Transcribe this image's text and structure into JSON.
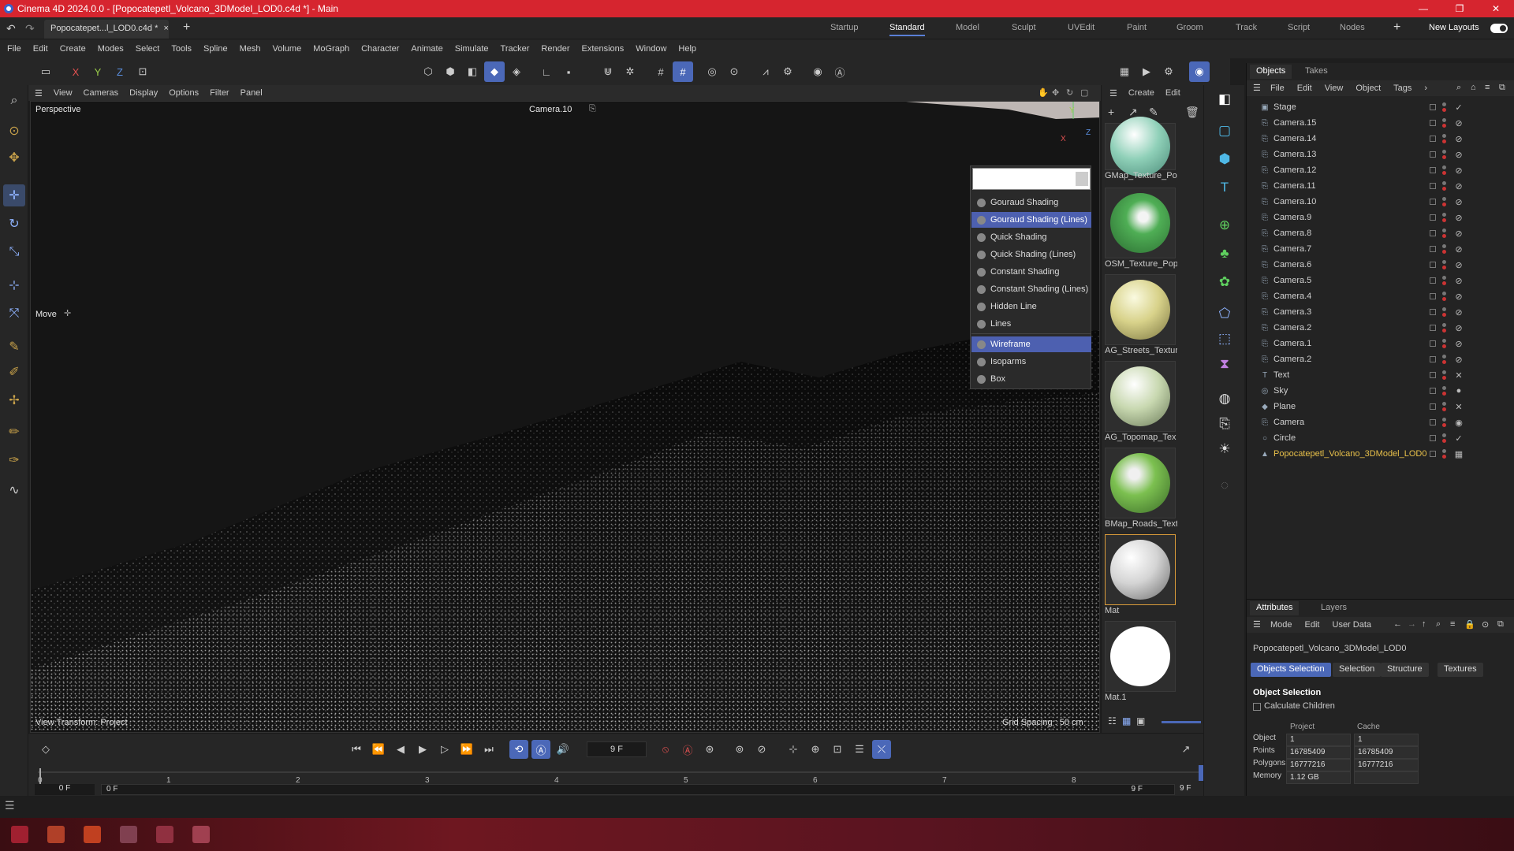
{
  "window": {
    "title": "Cinema 4D 2024.0.0 - [Popocatepetl_Volcano_3DModel_LOD0.c4d *] - Main",
    "minimize": "—",
    "maximize": "❐",
    "close": "✕"
  },
  "doc_tab": {
    "label": "Popocatepet...l_LOD0.c4d *",
    "close": "×",
    "add": "+"
  },
  "layouts": [
    "Startup",
    "Standard",
    "Model",
    "Sculpt",
    "UVEdit",
    "Paint",
    "Groom",
    "Track",
    "Script",
    "Nodes"
  ],
  "layout_add": "+",
  "new_layouts": "New Layouts",
  "menu": [
    "File",
    "Edit",
    "Create",
    "Modes",
    "Select",
    "Tools",
    "Spline",
    "Mesh",
    "Volume",
    "MoGraph",
    "Character",
    "Animate",
    "Simulate",
    "Tracker",
    "Render",
    "Extensions",
    "Window",
    "Help"
  ],
  "axes": {
    "x": "X",
    "y": "Y",
    "z": "Z"
  },
  "viewport": {
    "menu": [
      "View",
      "Cameras",
      "Display",
      "Options",
      "Filter",
      "Panel"
    ],
    "label": "Perspective",
    "camera": "Camera.10",
    "tool": "Move",
    "view_transform": "View Transform: Project",
    "grid_spacing": "Grid Spacing : 50 cm",
    "axis_x": "X",
    "axis_y": "Y",
    "axis_z": "Z"
  },
  "shading_menu": {
    "items": [
      {
        "label": "Gouraud Shading",
        "selected": false
      },
      {
        "label": "Gouraud Shading (Lines)",
        "selected": true
      },
      {
        "label": "Quick Shading",
        "selected": false
      },
      {
        "label": "Quick Shading (Lines)",
        "selected": false
      },
      {
        "label": "Constant Shading",
        "selected": false
      },
      {
        "label": "Constant Shading (Lines)",
        "selected": false
      },
      {
        "label": "Hidden Line",
        "selected": false
      },
      {
        "label": "Lines",
        "selected": false
      }
    ],
    "items2": [
      {
        "label": "Wireframe",
        "selected": true
      },
      {
        "label": "Isoparms",
        "selected": false
      },
      {
        "label": "Box",
        "selected": false
      }
    ]
  },
  "materials": {
    "menu": [
      "Create",
      "Edit"
    ],
    "items": [
      {
        "name": "GMap_Texture_Po",
        "color": "#8fd0b8"
      },
      {
        "name": "OSM_Texture_Pop",
        "color": "#4fae55"
      },
      {
        "name": "AG_Streets_Textur",
        "color": "#d8d28a"
      },
      {
        "name": "AG_Topomap_Tex",
        "color": "#c8d8b0"
      },
      {
        "name": "BMap_Roads_Text",
        "color": "#7cc050"
      },
      {
        "name": "Mat",
        "color": "#e4e4e4"
      },
      {
        "name": "Mat.1",
        "color": "#ffffff"
      }
    ]
  },
  "objects_panel": {
    "tabs": [
      "Objects",
      "Takes"
    ],
    "menu": [
      "File",
      "Edit",
      "View",
      "Object",
      "Tags"
    ],
    "rows": [
      {
        "name": "Stage",
        "icon": "▣",
        "tag": "✓"
      },
      {
        "name": "Camera.15",
        "icon": "⎘",
        "tag": "⊘"
      },
      {
        "name": "Camera.14",
        "icon": "⎘",
        "tag": "⊘"
      },
      {
        "name": "Camera.13",
        "icon": "⎘",
        "tag": "⊘"
      },
      {
        "name": "Camera.12",
        "icon": "⎘",
        "tag": "⊘"
      },
      {
        "name": "Camera.11",
        "icon": "⎘",
        "tag": "⊘"
      },
      {
        "name": "Camera.10",
        "icon": "⎘",
        "tag": "⊘"
      },
      {
        "name": "Camera.9",
        "icon": "⎘",
        "tag": "⊘"
      },
      {
        "name": "Camera.8",
        "icon": "⎘",
        "tag": "⊘"
      },
      {
        "name": "Camera.7",
        "icon": "⎘",
        "tag": "⊘"
      },
      {
        "name": "Camera.6",
        "icon": "⎘",
        "tag": "⊘"
      },
      {
        "name": "Camera.5",
        "icon": "⎘",
        "tag": "⊘"
      },
      {
        "name": "Camera.4",
        "icon": "⎘",
        "tag": "⊘"
      },
      {
        "name": "Camera.3",
        "icon": "⎘",
        "tag": "⊘"
      },
      {
        "name": "Camera.2",
        "icon": "⎘",
        "tag": "⊘"
      },
      {
        "name": "Camera.1",
        "icon": "⎘",
        "tag": "⊘"
      },
      {
        "name": "Camera.2",
        "icon": "⎘",
        "tag": "⊘"
      },
      {
        "name": "Text",
        "icon": "T",
        "tag": "✕"
      },
      {
        "name": "Sky",
        "icon": "◎",
        "tag": "●"
      },
      {
        "name": "Plane",
        "icon": "◆",
        "tag": "✕"
      },
      {
        "name": "Camera",
        "icon": "⎘",
        "tag": "◉"
      },
      {
        "name": "Circle",
        "icon": "○",
        "tag": "✓"
      },
      {
        "name": "Popocatepetl_Volcano_3DModel_LOD0",
        "icon": "▲",
        "tag": "▦"
      }
    ]
  },
  "attributes": {
    "tabs": [
      "Attributes",
      "Layers"
    ],
    "menu": [
      "Mode",
      "Edit",
      "User Data"
    ],
    "object_name": "Popocatepetl_Volcano_3DModel_LOD0",
    "buttons": [
      "Objects Selection",
      "Selection",
      "Structure",
      "Textures"
    ],
    "section": "Object Selection",
    "calc_children": "Calculate Children",
    "col_project": "Project",
    "col_cache": "Cache",
    "rows": [
      {
        "label": "Object",
        "project": "1",
        "cache": "1"
      },
      {
        "label": "Points",
        "project": "16785409",
        "cache": "16785409"
      },
      {
        "label": "Polygons",
        "project": "16777216",
        "cache": "16777216"
      },
      {
        "label": "Memory",
        "project": "1.12 GB",
        "cache": ""
      }
    ]
  },
  "timeline": {
    "current_frame": "9 F",
    "start": "0 F",
    "start2": "0 F",
    "end": "9 F",
    "end2": "9 F",
    "ticks": [
      "0",
      "1",
      "2",
      "3",
      "4",
      "5",
      "6",
      "7",
      "8"
    ]
  }
}
